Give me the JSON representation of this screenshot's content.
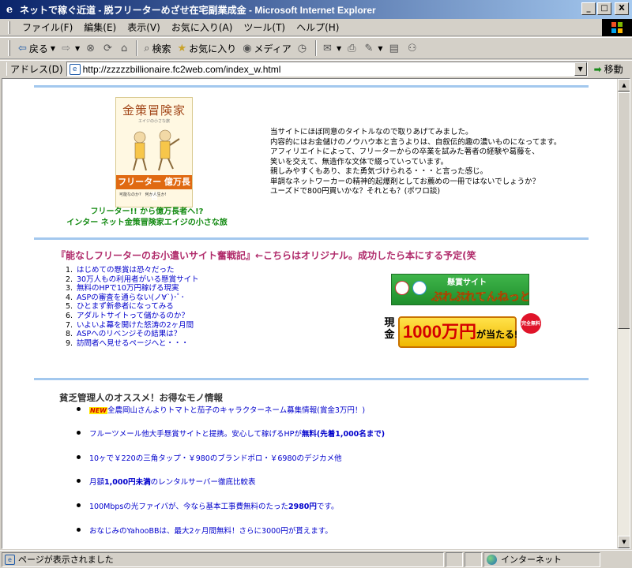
{
  "window": {
    "title": "ネットで稼ぐ近道 - 脱フリーターめざせ在宅副業成金 - Microsoft Internet Explorer",
    "buttons": {
      "minimize": "_",
      "maximize": "□",
      "close": "X"
    }
  },
  "menu": [
    "ファイル(F)",
    "編集(E)",
    "表示(V)",
    "お気に入り(A)",
    "ツール(T)",
    "ヘルプ(H)"
  ],
  "toolbar": {
    "back": "戻る",
    "search": "検索",
    "favorites": "お気に入り",
    "media": "メディア"
  },
  "address": {
    "label": "アドレス(D)",
    "url": "http://zzzzzbillionaire.fc2web.com/index_w.html",
    "go": "移動"
  },
  "book": {
    "cover_title": "金策冒険家",
    "cover_subtitle": "エイジの小さな旅",
    "cover_band": "フリーター 億万長者",
    "cover_low": "可能なのか?　何か人生か!",
    "caption_line1": "フリーター!! から億万長者へ!?",
    "caption_line2": "インター ネット金策冒険家エイジの小さな旅"
  },
  "intro": [
    "当サイトにほぼ同意のタイトルなので取りあげてみました。",
    "内容的にはお金儲けのノウハウ本と言うよりは、自叙伝的趣の濃いものになってます。",
    "アフィリエイトによって、フリーターからの卒業を試みた著者の経験や葛藤を、",
    "笑いを交えて、無造作な文体で綴っていっています。",
    "親しみやすくもあり、また勇気づけられる・・・と言った感じ。",
    "単調なネットワーカーの精神的起爆剤としてお薦めの一冊ではないでしょうか？",
    "ユーズドで800円買いかな？それとも？(ポワロ談)"
  ],
  "section2": {
    "title": "『能なしフリーターのお小遣いサイト奮戦記』←こちらはオリジナル。成功したら本にする予定(笑",
    "toc": [
      "はじめての懸賞は恐々だった",
      "30万人もの利用者がいる懸賞サイト",
      "無料のHPで10万円稼げる現実",
      "ASPの審査を通らない(ノ∀`)･ﾟ･",
      "ひとまず新参者になってみる",
      "アダルトサイトって儲かるのか？",
      "いよいよ幕を開けた怒涛の2ヶ月間",
      "ASPへのリベンジその結果は？",
      "訪問者へ見せるページへと・・・"
    ],
    "banner1": {
      "top": "懸賞サイト",
      "main": "ぷれぷれてんねっと"
    },
    "banner2": {
      "left": "現金",
      "main": "1000万円",
      "suffix": "が当たる!",
      "badge": "完全無料"
    }
  },
  "section3": {
    "title": "貧乏管理人のオススメ！お得なモノ情報",
    "items": [
      {
        "new": "NEW",
        "text": "全農岡山さんよりトマトと茄子のキャラクターネーム募集情報(賞金3万円！)"
      },
      {
        "text": "フルーツメール他大手懸賞サイトと提携。安心して稼げるHPが",
        "bold": "無料(先着1,000名まで)"
      },
      {
        "text": "10ヶで￥220の三角タップ・￥980のブランドポロ・￥6980のデジカメ他"
      },
      {
        "text": "月額",
        "bold": "1,000円未満",
        "text2": "のレンタルサーバー徹底比較表"
      },
      {
        "text": "100Mbpsの光ファイバが、今なら基本工事費無料のたった",
        "bold": "2980円",
        "text2": "です。"
      },
      {
        "text": "おなじみのYahooBBは、最大2ヶ月間無料！さらに3000円が貰えます。"
      }
    ]
  },
  "status": {
    "text": "ページが表示されました",
    "zone": "インターネット"
  },
  "colors": {
    "titlebar_start": "#0a246a",
    "rule": "#a3c8ee",
    "link": "#0000cc",
    "section_title": "#b02a6a",
    "book_caption": "#138a12"
  }
}
